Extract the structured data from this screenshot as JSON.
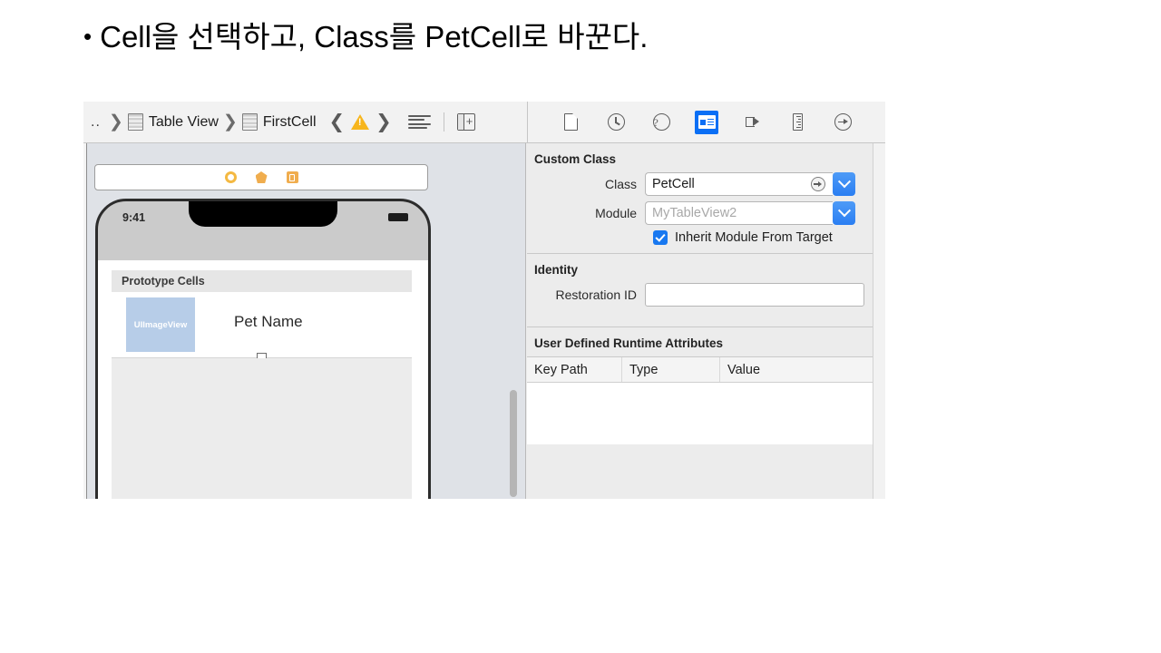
{
  "slide": {
    "bullet_text": "Cell을 선택하고, Class를 PetCell로 바꾼다.",
    "bullet_marker": "•"
  },
  "jump_bar": {
    "ellipsis": "..",
    "separator": "❯",
    "items": [
      {
        "label": "Table View",
        "icon": "table-view-icon"
      },
      {
        "label": "FirstCell",
        "icon": "table-view-cell-icon"
      }
    ],
    "prev_arrow": "❮",
    "next_arrow": "❯",
    "warning_icon": "warning-triangle-icon",
    "align_icon": "text-align-icon",
    "panel_icon": "add-editor-icon"
  },
  "inspector_tabs": [
    {
      "name": "file-inspector-icon",
      "selected": false
    },
    {
      "name": "history-inspector-icon",
      "selected": false
    },
    {
      "name": "quick-help-inspector-icon",
      "selected": false
    },
    {
      "name": "identity-inspector-icon",
      "selected": true
    },
    {
      "name": "attributes-inspector-icon",
      "selected": false
    },
    {
      "name": "size-inspector-icon",
      "selected": false
    },
    {
      "name": "connections-inspector-icon",
      "selected": false
    }
  ],
  "canvas": {
    "scene_dock": [
      {
        "name": "view-controller-icon"
      },
      {
        "name": "first-responder-icon"
      },
      {
        "name": "exit-icon"
      }
    ],
    "phone": {
      "status_time": "9:41",
      "prototype_cells_header": "Prototype Cells",
      "cell": {
        "image_view_label": "UIImageView",
        "title_label": "Pet Name"
      }
    }
  },
  "inspector": {
    "custom_class": {
      "section_title": "Custom Class",
      "class_label": "Class",
      "class_value": "PetCell",
      "module_label": "Module",
      "module_placeholder": "MyTableView2",
      "inherit_label": "Inherit Module From Target",
      "inherit_checked": true
    },
    "identity": {
      "section_title": "Identity",
      "restoration_id_label": "Restoration ID",
      "restoration_id_value": ""
    },
    "user_defined_runtime_attributes": {
      "section_title": "User Defined Runtime Attributes",
      "columns": [
        "Key Path",
        "Type",
        "Value"
      ],
      "rows": []
    }
  },
  "colors": {
    "accent_blue": "#1878f0",
    "warning_yellow": "#f7b51c",
    "dock_orange": "#f0ad4e",
    "imageview_blue": "#b7cde8"
  }
}
